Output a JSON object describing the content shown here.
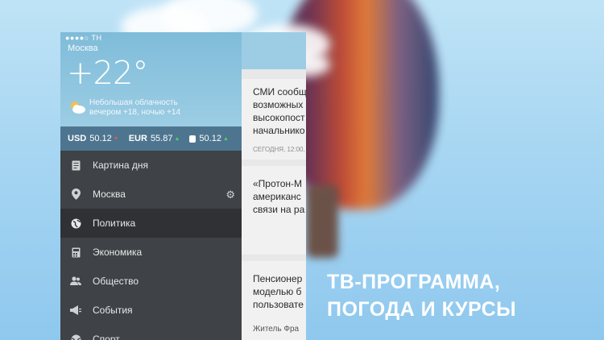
{
  "status_bar": {
    "carrier": "●●●●○ TH"
  },
  "weather": {
    "city": "Москва",
    "temperature": "+22°",
    "condition": "Небольшая облачность",
    "forecast": "вечером +18, ночью +14",
    "icon": "partly-cloudy-icon"
  },
  "rates": {
    "usd": {
      "label": "USD",
      "value": "50.12",
      "trend": "down"
    },
    "eur": {
      "label": "EUR",
      "value": "55.87",
      "trend": "up"
    },
    "oil": {
      "value": "50.12",
      "trend": "up",
      "icon": "oil-barrel-icon"
    }
  },
  "menu": {
    "items": [
      {
        "label": "Картина дня",
        "icon": "document-icon"
      },
      {
        "label": "Москва",
        "icon": "location-pin-icon"
      },
      {
        "label": "Политика",
        "icon": "globe-icon"
      },
      {
        "label": "Экономика",
        "icon": "calculator-icon"
      },
      {
        "label": "Общество",
        "icon": "people-icon"
      },
      {
        "label": "События",
        "icon": "megaphone-icon"
      },
      {
        "label": "Спорт",
        "icon": "ball-icon"
      }
    ],
    "active_index": 2
  },
  "news": [
    {
      "title_lines": [
        "СМИ сообщ",
        "возможных",
        "высокопост",
        "начальнико"
      ],
      "meta": "СЕГОДНЯ, 12:00,"
    },
    {
      "title_lines": [
        "«Протон-М",
        "американс",
        "связи на ра"
      ],
      "meta": ""
    },
    {
      "title_lines": [
        "Пенсионер",
        "моделью б",
        "пользовате"
      ],
      "meta": "Житель Фра"
    }
  ],
  "caption": {
    "line1": "ТВ-ПРОГРАММА,",
    "line2": "ПОГОДА И КУРСЫ"
  },
  "colors": {
    "drawer": "#3f4246",
    "rates_bar": "#4e7590",
    "active_item": "#2f3134"
  }
}
